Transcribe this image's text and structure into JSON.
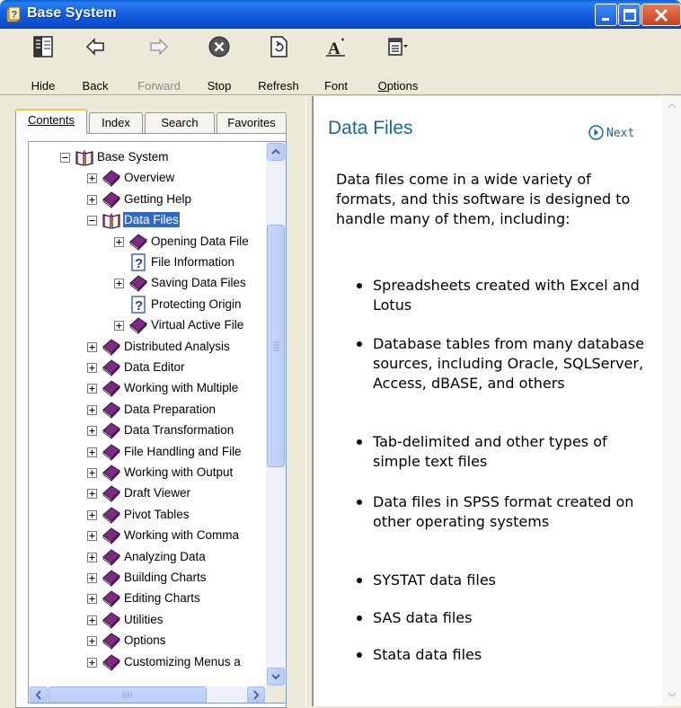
{
  "window": {
    "title": "Base System",
    "controls": [
      "minimize",
      "maximize",
      "close"
    ]
  },
  "toolbar": {
    "hide_label": "Hide",
    "back_label": "Back",
    "forward_label": "Forward",
    "stop_label": "Stop",
    "refresh_label": "Refresh",
    "font_label": "Font",
    "options_label": "Options"
  },
  "tabs": {
    "contents": "Contents",
    "index": "Index",
    "search": "Search",
    "favorites": "Favorites",
    "active": "Contents"
  },
  "tree": {
    "items": [
      {
        "label": "Base System",
        "icon": "open-book-icon",
        "expander": "minus"
      },
      {
        "label": "Overview",
        "icon": "book-icon",
        "expander": "plus"
      },
      {
        "label": "Getting Help",
        "icon": "book-icon",
        "expander": "plus"
      },
      {
        "label": "Data Files",
        "icon": "open-book-icon",
        "expander": "minus",
        "selected": true
      },
      {
        "label": "Opening Data File",
        "icon": "book-icon",
        "expander": "plus"
      },
      {
        "label": "File Information",
        "icon": "help-page-icon",
        "expander": "none"
      },
      {
        "label": "Saving Data Files",
        "icon": "book-icon",
        "expander": "plus"
      },
      {
        "label": "Protecting Origin",
        "icon": "help-page-icon",
        "expander": "none"
      },
      {
        "label": "Virtual Active File",
        "icon": "book-icon",
        "expander": "plus"
      },
      {
        "label": "Distributed Analysis",
        "icon": "book-icon",
        "expander": "plus"
      },
      {
        "label": "Data Editor",
        "icon": "book-icon",
        "expander": "plus"
      },
      {
        "label": "Working with Multiple",
        "icon": "book-icon",
        "expander": "plus"
      },
      {
        "label": "Data Preparation",
        "icon": "book-icon",
        "expander": "plus"
      },
      {
        "label": "Data Transformation",
        "icon": "book-icon",
        "expander": "plus"
      },
      {
        "label": "File Handling and File",
        "icon": "book-icon",
        "expander": "plus"
      },
      {
        "label": "Working with Output",
        "icon": "book-icon",
        "expander": "plus"
      },
      {
        "label": "Draft Viewer",
        "icon": "book-icon",
        "expander": "plus"
      },
      {
        "label": "Pivot Tables",
        "icon": "book-icon",
        "expander": "plus"
      },
      {
        "label": "Working with Comma",
        "icon": "book-icon",
        "expander": "plus"
      },
      {
        "label": "Analyzing Data",
        "icon": "book-icon",
        "expander": "plus"
      },
      {
        "label": "Building Charts",
        "icon": "book-icon",
        "expander": "plus"
      },
      {
        "label": "Editing Charts",
        "icon": "book-icon",
        "expander": "plus"
      },
      {
        "label": "Utilities",
        "icon": "book-icon",
        "expander": "plus"
      },
      {
        "label": "Options",
        "icon": "book-icon",
        "expander": "plus"
      },
      {
        "label": "Customizing Menus a",
        "icon": "book-icon",
        "expander": "plus"
      }
    ]
  },
  "content": {
    "title": "Data Files",
    "next_label": "Next",
    "intro": "Data files come in a wide variety of formats, and this software is designed to handle many of them, including:",
    "bullets": [
      "Spreadsheets created with Excel and Lotus",
      "Database tables from many database sources, including Oracle, SQLServer, Access, dBASE, and others",
      "Tab-delimited and other types of simple text files",
      "Data files in SPSS format created on other operating systems",
      "SYSTAT data files",
      "SAS data files",
      "Stata data files"
    ]
  },
  "colors": {
    "title_bar": "#1560e0",
    "heading": "#1b6a8b",
    "selection": "#316ac5",
    "book": "#7a2d7f"
  }
}
